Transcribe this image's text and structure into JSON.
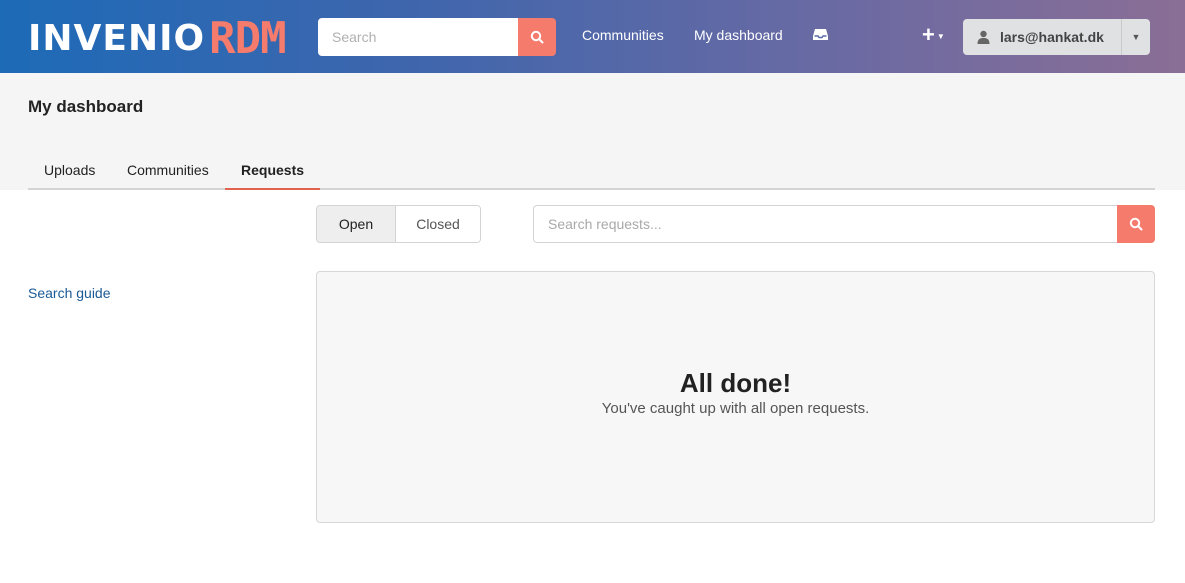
{
  "header": {
    "logo_main": "INVENIO",
    "logo_accent": "RDM",
    "search_placeholder": "Search",
    "nav": [
      "Communities",
      "My dashboard"
    ],
    "user_email": "lars@hankat.dk"
  },
  "page": {
    "title": "My dashboard",
    "tabs": [
      {
        "label": "Uploads",
        "active": false
      },
      {
        "label": "Communities",
        "active": false
      },
      {
        "label": "Requests",
        "active": true
      }
    ]
  },
  "filters": {
    "status_options": [
      "Open",
      "Closed"
    ],
    "selected": "Open",
    "search_placeholder": "Search requests..."
  },
  "sidebar": {
    "search_guide": "Search guide"
  },
  "empty_state": {
    "title": "All done!",
    "message": "You've caught up with all open requests."
  },
  "colors": {
    "accent": "#f57b6c",
    "header_start": "#1d6ab7",
    "header_end": "#8a6e95",
    "tab_underline": "#e1624f",
    "link": "#1a5a96"
  },
  "icons": {
    "search": "search-icon",
    "inbox": "inbox-icon",
    "plus": "plus-icon",
    "user": "user-icon",
    "caret": "caret-down-icon"
  }
}
